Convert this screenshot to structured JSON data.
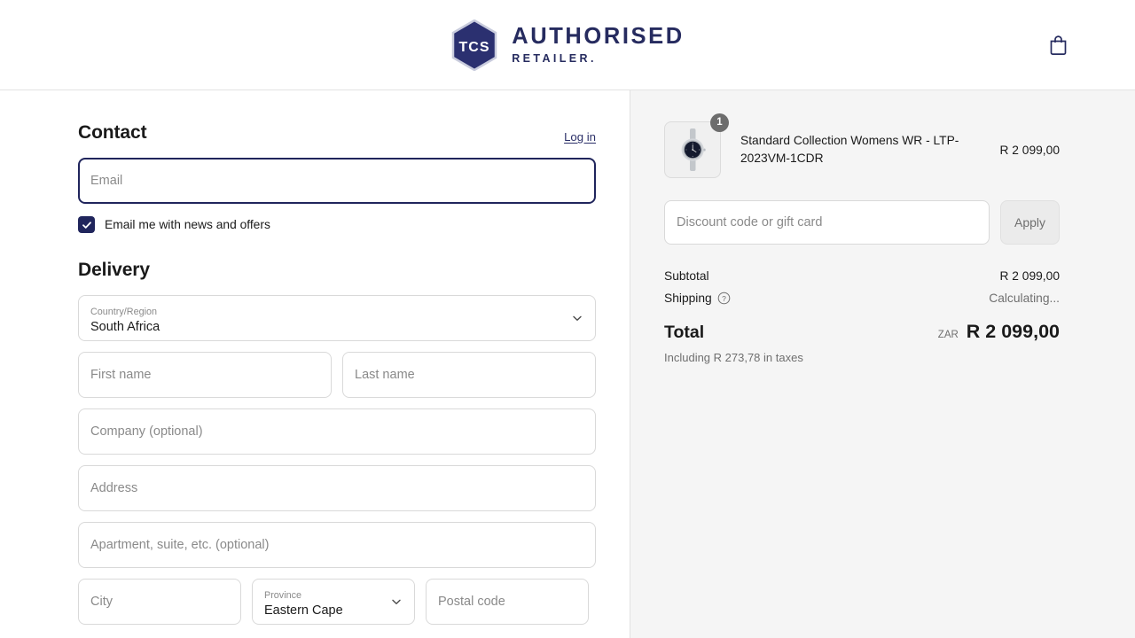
{
  "header": {
    "logo_mark_text": "TCS",
    "brand_line1": "AUTHORISED",
    "brand_line2": "RETAILER.",
    "cart_icon": "shopping-bag-icon",
    "brand_color": "#262b5f"
  },
  "contact": {
    "title": "Contact",
    "login_label": "Log in",
    "email_placeholder": "Email",
    "email_value": "",
    "newsletter_label": "Email me with news and offers",
    "newsletter_checked": true,
    "focus_color": "#20255c"
  },
  "delivery": {
    "title": "Delivery",
    "country": {
      "label": "Country/Region",
      "value": "South Africa"
    },
    "first_name_placeholder": "First name",
    "last_name_placeholder": "Last name",
    "company_placeholder": "Company (optional)",
    "address_placeholder": "Address",
    "apartment_placeholder": "Apartment, suite, etc. (optional)",
    "city_placeholder": "City",
    "province": {
      "label": "Province",
      "value": "Eastern Cape"
    },
    "postal_placeholder": "Postal code"
  },
  "summary": {
    "item": {
      "name": "Standard Collection Womens WR - LTP-2023VM-1CDR",
      "price": "R 2 099,00",
      "quantity": "1",
      "image": "wristwatch-thumbnail"
    },
    "discount_placeholder": "Discount code or gift card",
    "apply_label": "Apply",
    "subtotal_label": "Subtotal",
    "subtotal_value": "R 2 099,00",
    "shipping_label": "Shipping",
    "shipping_value": "Calculating...",
    "shipping_help_icon": "question-circle-icon",
    "total_label": "Total",
    "total_currency": "ZAR",
    "total_value": "R 2 099,00",
    "tax_note": "Including R 273,78 in taxes"
  }
}
